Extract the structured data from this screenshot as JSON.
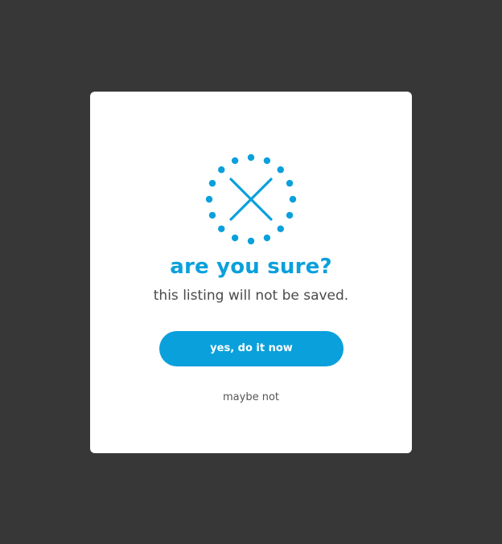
{
  "dialog": {
    "icon": "dotted-circle-x-icon",
    "title": "are you sure?",
    "message": "this listing will not be saved.",
    "confirm_label": "yes, do it now",
    "cancel_label": "maybe not"
  },
  "colors": {
    "backdrop": "#373737",
    "accent": "#0aa0dc",
    "dialog_bg": "#ffffff",
    "text": "#4a4a4a"
  }
}
